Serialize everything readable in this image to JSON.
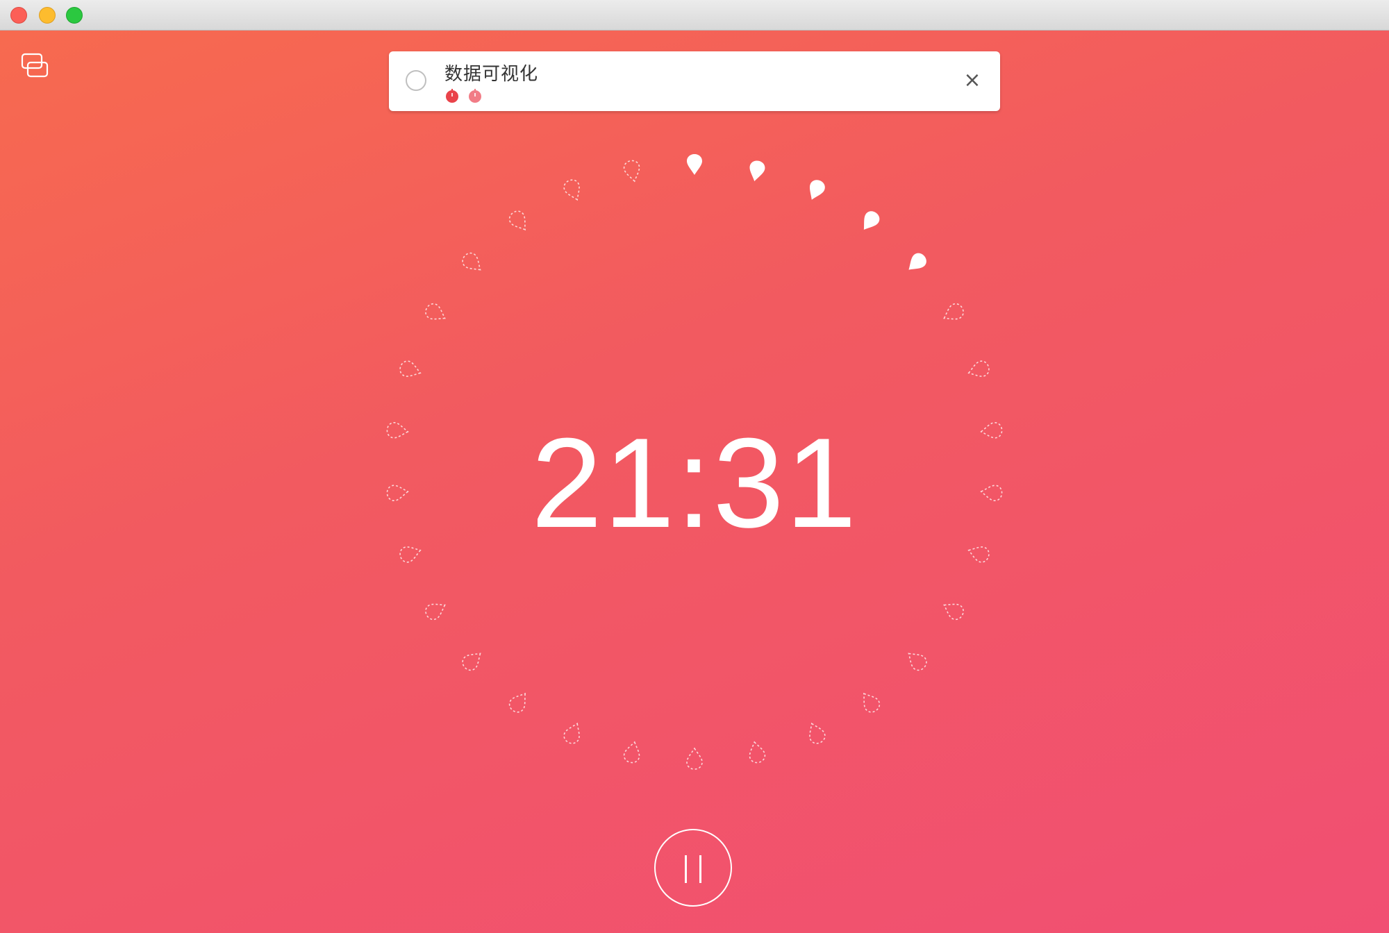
{
  "window": {
    "controls": [
      "close",
      "minimize",
      "maximize"
    ]
  },
  "toolbar": {
    "mini_mode_icon": "mini-window-icon"
  },
  "task": {
    "title": "数据可视化",
    "pomodoros_completed": 1,
    "pomodoros_estimated": 2,
    "close_symbol": "×"
  },
  "timer": {
    "display": "21:31",
    "total_markers": 30,
    "filled_markers": 5,
    "marker_icon": "drop-icon"
  },
  "controls": {
    "pause_icon": "pause-icon"
  },
  "colors": {
    "background_start": "#f76a4f",
    "background_end": "#f14f73",
    "accent": "#ffffff",
    "pomo_done": "#e9434a",
    "pomo_pending": "#f17c86"
  }
}
